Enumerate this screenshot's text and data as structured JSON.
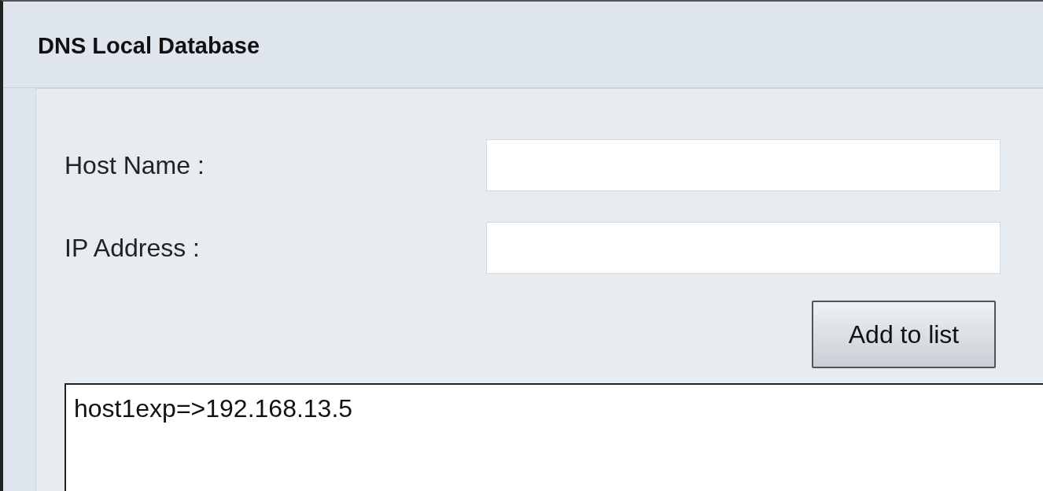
{
  "section": {
    "title": "DNS Local Database"
  },
  "fields": [
    {
      "label": "Host Name :"
    },
    {
      "label": "IP Address :"
    }
  ],
  "add_button": {
    "label": "Add to list"
  },
  "list": {
    "entries": [
      "host1exp=>192.168.13.5"
    ]
  }
}
